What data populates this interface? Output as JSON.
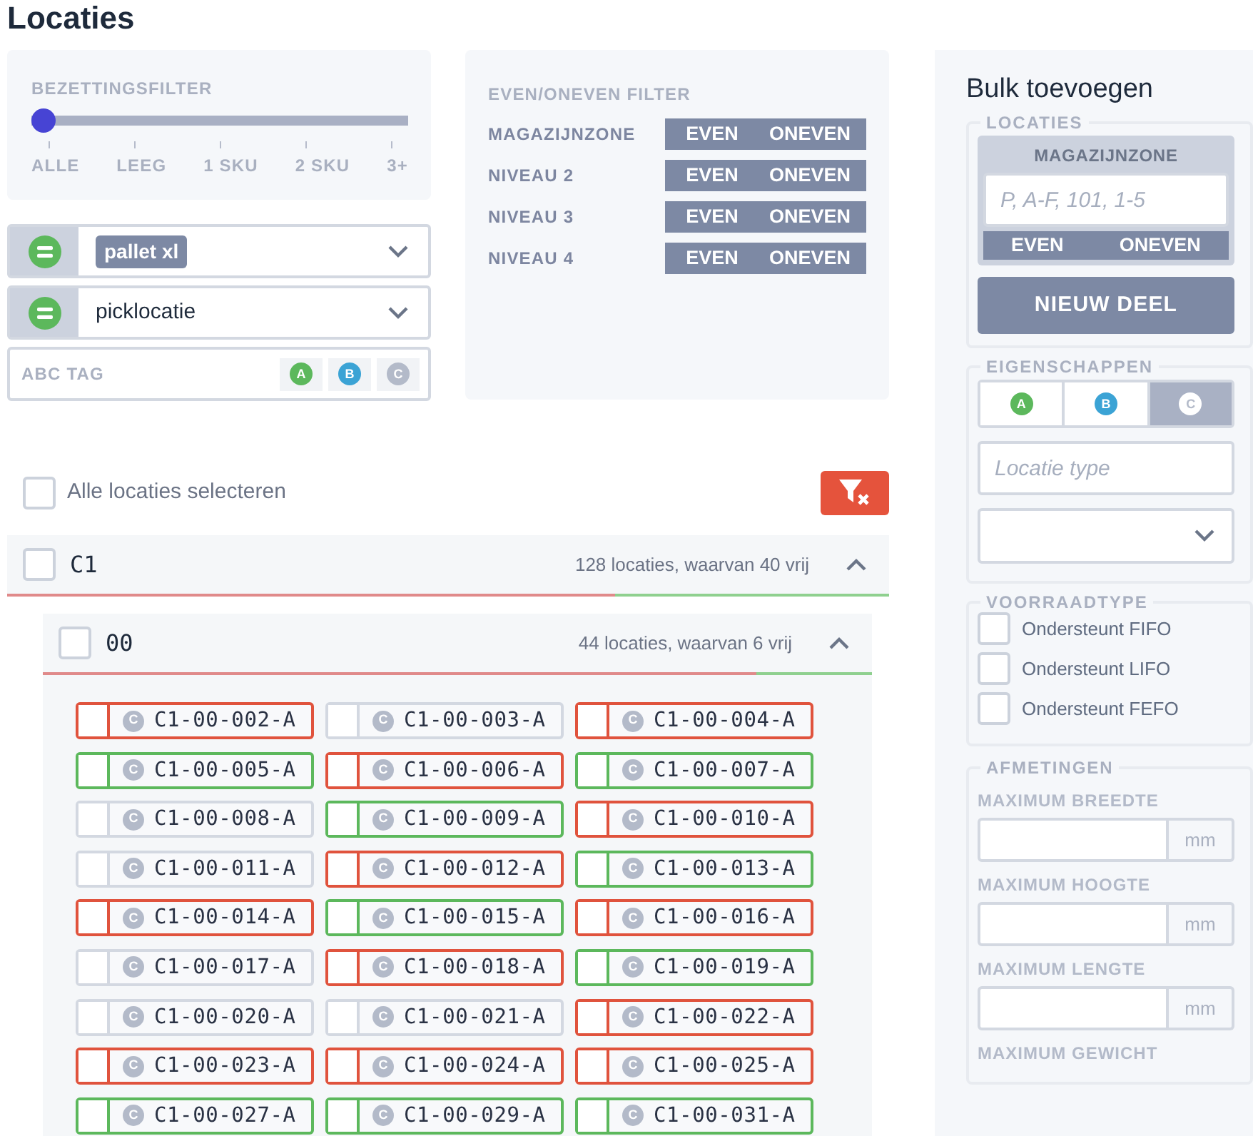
{
  "page_title": "Locaties",
  "occupancy_filter": {
    "label": "BEZETTINGSFILTER",
    "level": 0,
    "ticks": [
      "ALLE",
      "LEEG",
      "1 SKU",
      "2 SKU",
      "3+"
    ]
  },
  "filters": [
    {
      "kind": "select",
      "chips": [
        "pallet xl"
      ]
    },
    {
      "kind": "select",
      "value": "picklocatie"
    },
    {
      "kind": "abc",
      "label": "ABC TAG",
      "tags": [
        {
          "letter": "A",
          "color": "#5cb85c",
          "selected": false
        },
        {
          "letter": "B",
          "color": "#3ba3d5",
          "selected": false
        },
        {
          "letter": "C",
          "color": "#b3bac9",
          "selected": false
        }
      ]
    }
  ],
  "parity_filter": {
    "title": "EVEN/ONEVEN FILTER",
    "rows": [
      {
        "label": "MAGAZIJNZONE",
        "even": "EVEN",
        "odd": "ONEVEN"
      },
      {
        "label": "NIVEAU 2",
        "even": "EVEN",
        "odd": "ONEVEN"
      },
      {
        "label": "NIVEAU 3",
        "even": "EVEN",
        "odd": "ONEVEN"
      },
      {
        "label": "NIVEAU 4",
        "even": "EVEN",
        "odd": "ONEVEN"
      }
    ]
  },
  "select_all": {
    "label": "Alle locaties selecteren",
    "checked": false
  },
  "groups": [
    {
      "name": "C1",
      "summary": "128 locaties, waarvan 40 vrij",
      "checked": false,
      "expanded": true,
      "level": 0.69,
      "children": [
        {
          "name": "00",
          "summary": "44 locaties, waarvan 6 vrij",
          "checked": false,
          "expanded": true,
          "level": 0.86,
          "locations": [
            {
              "code": "C1-00-002-A",
              "tag": "C",
              "color": "#e0533d",
              "checked": false
            },
            {
              "code": "C1-00-003-A",
              "tag": "C",
              "color": "#d3d8e1",
              "checked": false
            },
            {
              "code": "C1-00-004-A",
              "tag": "C",
              "color": "#e0533d",
              "checked": false
            },
            {
              "code": "C1-00-005-A",
              "tag": "C",
              "color": "#5cb85c",
              "checked": false
            },
            {
              "code": "C1-00-006-A",
              "tag": "C",
              "color": "#e0533d",
              "checked": false
            },
            {
              "code": "C1-00-007-A",
              "tag": "C",
              "color": "#5cb85c",
              "checked": false
            },
            {
              "code": "C1-00-008-A",
              "tag": "C",
              "color": "#d3d8e1",
              "checked": false
            },
            {
              "code": "C1-00-009-A",
              "tag": "C",
              "color": "#5cb85c",
              "checked": false
            },
            {
              "code": "C1-00-010-A",
              "tag": "C",
              "color": "#e0533d",
              "checked": false
            },
            {
              "code": "C1-00-011-A",
              "tag": "C",
              "color": "#d3d8e1",
              "checked": false
            },
            {
              "code": "C1-00-012-A",
              "tag": "C",
              "color": "#e0533d",
              "checked": false
            },
            {
              "code": "C1-00-013-A",
              "tag": "C",
              "color": "#5cb85c",
              "checked": false
            },
            {
              "code": "C1-00-014-A",
              "tag": "C",
              "color": "#e0533d",
              "checked": false
            },
            {
              "code": "C1-00-015-A",
              "tag": "C",
              "color": "#5cb85c",
              "checked": false
            },
            {
              "code": "C1-00-016-A",
              "tag": "C",
              "color": "#e0533d",
              "checked": false
            },
            {
              "code": "C1-00-017-A",
              "tag": "C",
              "color": "#d3d8e1",
              "checked": false
            },
            {
              "code": "C1-00-018-A",
              "tag": "C",
              "color": "#e0533d",
              "checked": false
            },
            {
              "code": "C1-00-019-A",
              "tag": "C",
              "color": "#5cb85c",
              "checked": false
            },
            {
              "code": "C1-00-020-A",
              "tag": "C",
              "color": "#d3d8e1",
              "checked": false
            },
            {
              "code": "C1-00-021-A",
              "tag": "C",
              "color": "#d3d8e1",
              "checked": false
            },
            {
              "code": "C1-00-022-A",
              "tag": "C",
              "color": "#e0533d",
              "checked": false
            },
            {
              "code": "C1-00-023-A",
              "tag": "C",
              "color": "#e0533d",
              "checked": false
            },
            {
              "code": "C1-00-024-A",
              "tag": "C",
              "color": "#e0533d",
              "checked": false
            },
            {
              "code": "C1-00-025-A",
              "tag": "C",
              "color": "#e0533d",
              "checked": false
            },
            {
              "code": "C1-00-027-A",
              "tag": "C",
              "color": "#5cb85c",
              "checked": false
            },
            {
              "code": "C1-00-029-A",
              "tag": "C",
              "color": "#5cb85c",
              "checked": false
            },
            {
              "code": "C1-00-031-A",
              "tag": "C",
              "color": "#5cb85c",
              "checked": false
            }
          ]
        }
      ]
    }
  ],
  "bulk_add": {
    "title": "Bulk toevoegen",
    "locations": {
      "legend": "LOCATIES",
      "parts": [
        {
          "label": "MAGAZIJNZONE",
          "placeholder": "P, A-F, 101, 1-5",
          "even": "EVEN",
          "odd": "ONEVEN"
        }
      ],
      "add_button": "NIEUW DEEL"
    },
    "properties": {
      "legend": "EIGENSCHAPPEN",
      "tags": [
        {
          "letter": "A",
          "color": "#5cb85c",
          "selected": false
        },
        {
          "letter": "B",
          "color": "#3ba3d5",
          "selected": false
        },
        {
          "letter": "C",
          "color": "#b3bac9",
          "selected": true
        }
      ],
      "type_placeholder": "Locatie type"
    },
    "stock_type": {
      "legend": "VOORRAADTYPE",
      "options": [
        {
          "label": "Ondersteunt FIFO",
          "checked": false
        },
        {
          "label": "Ondersteunt LIFO",
          "checked": false
        },
        {
          "label": "Ondersteunt FEFO",
          "checked": false
        }
      ]
    },
    "dimensions": {
      "legend": "AFMETINGEN",
      "fields": [
        {
          "label": "MAXIMUM BREEDTE",
          "unit": "mm"
        },
        {
          "label": "MAXIMUM HOOGTE",
          "unit": "mm"
        },
        {
          "label": "MAXIMUM LENGTE",
          "unit": "mm"
        },
        {
          "label": "MAXIMUM GEWICHT"
        }
      ]
    }
  }
}
